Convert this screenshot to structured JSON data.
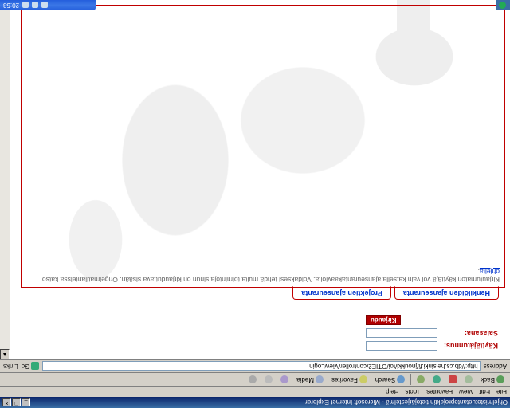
{
  "window": {
    "title": "Ohjelmistotuotantoprojektin tietojärjestelmä - Microsoft Internet Explorer",
    "min": "_",
    "max": "□",
    "close": "×"
  },
  "menu": {
    "file": "File",
    "edit": "Edit",
    "view": "View",
    "favorites": "Favorites",
    "tools": "Tools",
    "help": "Help"
  },
  "toolbar": {
    "back": "Back",
    "search": "Search",
    "favorites": "Favorites",
    "media": "Media"
  },
  "address": {
    "label": "Address",
    "url": "http://db.cs.helsinki.fi/jnoukki/toi/OTIE2/controller/ViewLogin",
    "go": "Go",
    "links": "Links"
  },
  "login": {
    "user_label": "Käyttäjätunnus:",
    "pass_label": "Salasana:",
    "submit": "Kirjaudu"
  },
  "tabs": {
    "t1": "Henkilöiden ajanseuranta",
    "t2": "Projektien ajanseuranta"
  },
  "panel": {
    "info_a": "Kirjautumaton käyttäjä voi vain katsella ajanseurantakaavioita. Voidaksesi tehdä muita toimintoja sinun on kirjauduttava sisään. Ongelmatilanteissa katso ",
    "info_link": "ohjeita",
    "info_b": "."
  },
  "tray": {
    "clock": "20:58"
  }
}
